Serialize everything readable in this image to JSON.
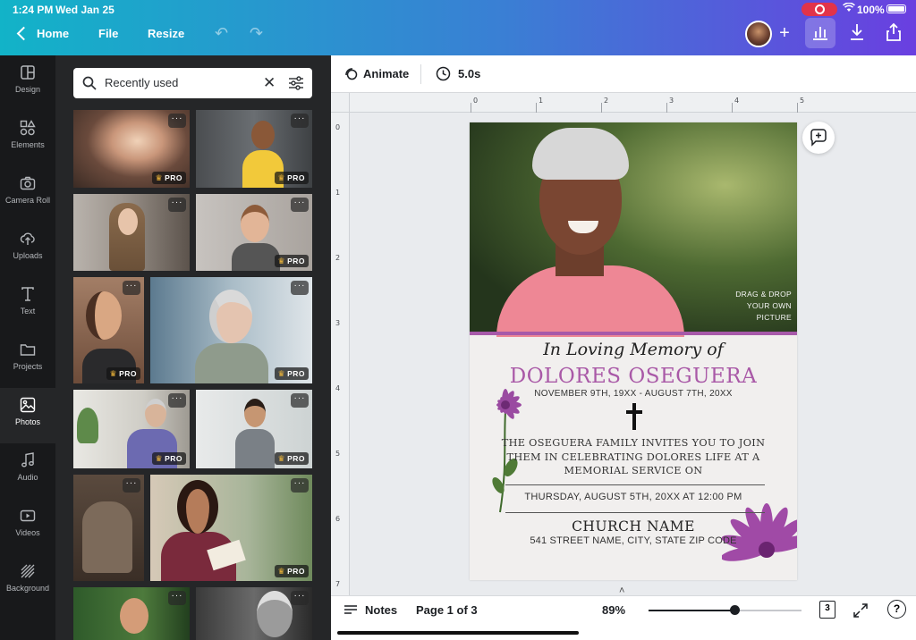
{
  "status_bar": {
    "time": "1:24 PM",
    "date": "Wed Jan 25",
    "battery": "100%"
  },
  "top_nav": {
    "back_label": "Home",
    "file_label": "File",
    "resize_label": "Resize",
    "icons": [
      "chevron-left-icon",
      "undo-icon",
      "redo-icon",
      "avatar",
      "plus-icon",
      "bar-chart-icon",
      "download-icon",
      "share-icon"
    ]
  },
  "sidebar": {
    "items": [
      {
        "label": "Design",
        "icon": "design-icon"
      },
      {
        "label": "Elements",
        "icon": "shapes-icon"
      },
      {
        "label": "Camera Roll",
        "icon": "camera-icon"
      },
      {
        "label": "Uploads",
        "icon": "cloud-upload-icon"
      },
      {
        "label": "Text",
        "icon": "text-icon"
      },
      {
        "label": "Projects",
        "icon": "folder-icon"
      },
      {
        "label": "Photos",
        "icon": "image-icon"
      },
      {
        "label": "Audio",
        "icon": "music-note-icon"
      },
      {
        "label": "Videos",
        "icon": "video-icon"
      },
      {
        "label": "Background",
        "icon": "pattern-icon"
      }
    ],
    "active": "Photos"
  },
  "photo_panel": {
    "search_value": "Recently used",
    "pro_label": "PRO",
    "more_label": "···"
  },
  "editor_toolbar": {
    "animate_label": "Animate",
    "duration": "5.0s"
  },
  "ruler": {
    "h_numbers": [
      "0",
      "1",
      "2",
      "3",
      "4",
      "5"
    ],
    "v_numbers": [
      "0",
      "1",
      "2",
      "3",
      "4",
      "5",
      "6",
      "7"
    ]
  },
  "design": {
    "dragdrop_lines": [
      "DRAG & DROP",
      "YOUR OWN",
      "PICTURE"
    ],
    "heading": "In Loving Memory of",
    "name": "DOLORES OSEGUERA",
    "dates": "NOVEMBER 9TH, 19XX - AUGUST 7TH, 20XX",
    "invite_lines": [
      "THE OSEGUERA FAMILY INVITES YOU TO JOIN",
      "THEM IN CELEBRATING DOLORES LIFE AT A",
      "MEMORIAL SERVICE ON"
    ],
    "service_time": "THURSDAY, AUGUST 5TH, 20XX AT 12:00 PM",
    "church": "CHURCH NAME",
    "address": "541 STREET NAME, CITY, STATE ZIP CODE",
    "accent_color": "#a959a7"
  },
  "bottom_bar": {
    "notes_label": "Notes",
    "page_info": "Page 1 of 3",
    "zoom": "89%",
    "zoom_fraction": 0.56,
    "page_count": "3",
    "help_label": "?"
  }
}
